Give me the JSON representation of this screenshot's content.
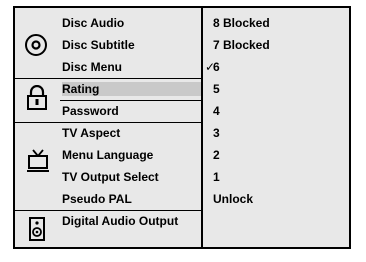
{
  "menu": {
    "groups": [
      {
        "icon": "disc-icon",
        "items": [
          "Disc Audio",
          "Disc Subtitle",
          "Disc Menu"
        ]
      },
      {
        "icon": "lock-icon",
        "items": [
          "Rating",
          "Password"
        ]
      },
      {
        "icon": "tv-icon",
        "items": [
          "TV Aspect",
          "Menu Language",
          "TV Output Select",
          "Pseudo PAL"
        ]
      },
      {
        "icon": "speaker-icon",
        "items": [
          "Digital Audio Output"
        ]
      }
    ],
    "selected_item": "Rating"
  },
  "options": {
    "items": [
      "8  Blocked",
      "7  Blocked",
      "6",
      "5",
      "4",
      "3",
      "2",
      "1",
      "Unlock"
    ],
    "checked_index": 2,
    "check_mark": "✓"
  },
  "colors": {
    "panel": "#e8e8e8",
    "highlight": "#c9c9c9",
    "border": "#000000"
  }
}
